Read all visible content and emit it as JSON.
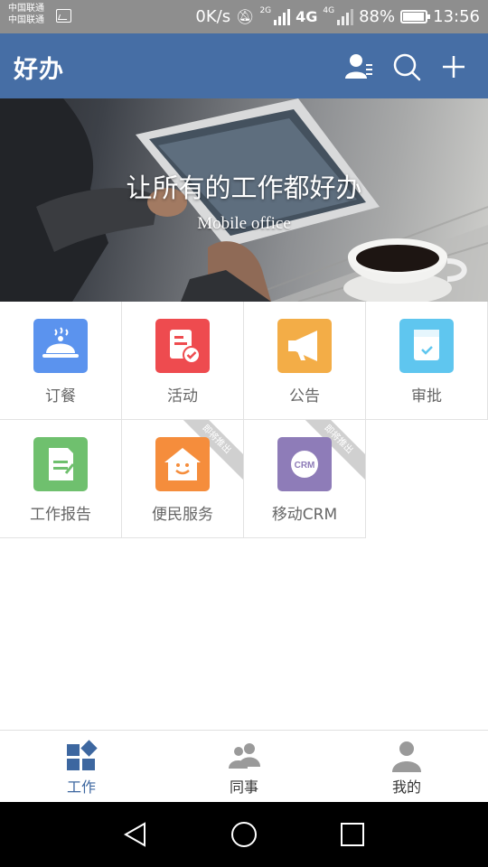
{
  "status_bar": {
    "carrier_1": "中国联通",
    "carrier_2": "中国联通",
    "speed": "0K/s",
    "net_2g": "2G",
    "net_4g": "4G",
    "net_4g_small": "4G",
    "battery": "88%",
    "battery_level": 0.88,
    "time": "13:56"
  },
  "header": {
    "title": "好办",
    "icons": [
      "contacts-icon",
      "search-icon",
      "add-icon"
    ]
  },
  "banner": {
    "title": "让所有的工作都好办",
    "subtitle": "Mobile office"
  },
  "apps": [
    {
      "label": "订餐",
      "icon": "meal-icon",
      "color": "#5b93ee"
    },
    {
      "label": "活动",
      "icon": "activity-icon",
      "color": "#ee4b4f"
    },
    {
      "label": "公告",
      "icon": "announcement-icon",
      "color": "#f3ad47"
    },
    {
      "label": "审批",
      "icon": "approval-icon",
      "color": "#5fc6ef"
    },
    {
      "label": "工作报告",
      "icon": "work-report-icon",
      "color": "#6fc06e"
    },
    {
      "label": "便民服务",
      "icon": "convenience-service-icon",
      "color": "#f58d3c",
      "ribbon": "即将推出"
    },
    {
      "label": "移动CRM",
      "icon": "crm-icon",
      "color": "#8e7cb8",
      "ribbon": "即将推出",
      "icon_text": "CRM"
    }
  ],
  "bottom_nav": [
    {
      "label": "工作",
      "icon": "work-icon",
      "active": true
    },
    {
      "label": "同事",
      "icon": "colleagues-icon",
      "active": false
    },
    {
      "label": "我的",
      "icon": "profile-icon",
      "active": false
    }
  ],
  "colors": {
    "header_bg": "#466ea5",
    "active_tab": "#3d67a0",
    "inactive_tab_icon": "#9a9a9a"
  }
}
